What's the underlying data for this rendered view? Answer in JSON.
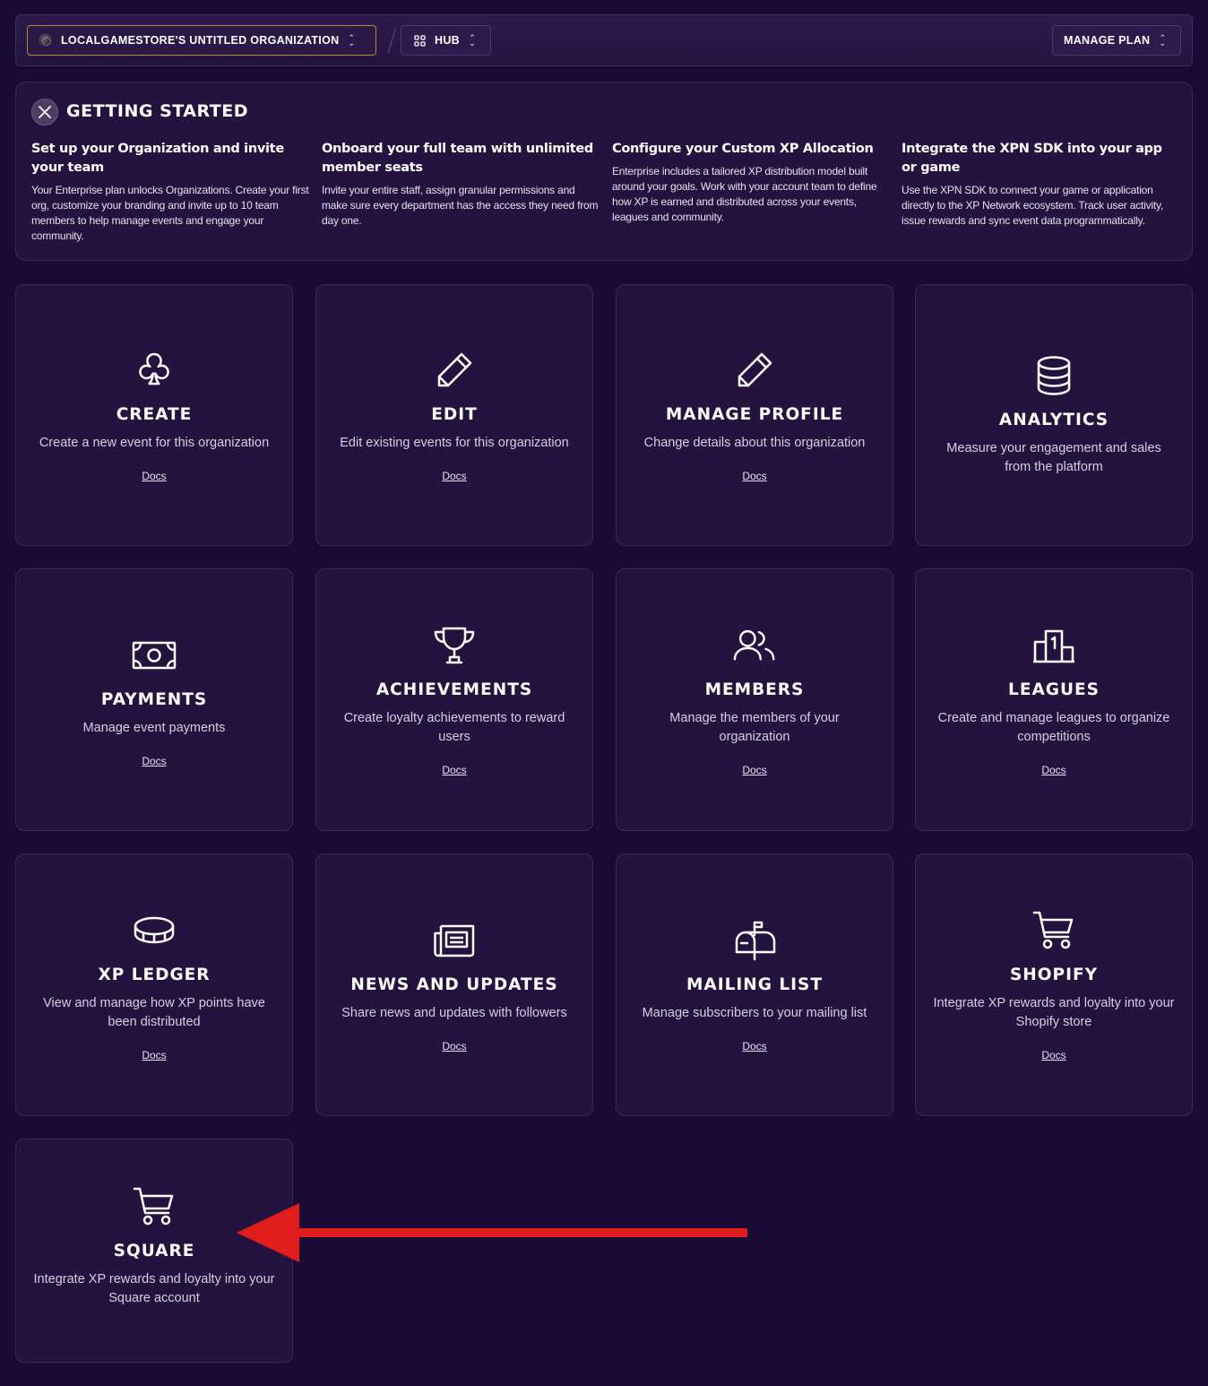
{
  "topbar": {
    "org_label": "LOCALGAMESTORE'S UNTITLED ORGANIZATION",
    "hub_label": "HUB",
    "plan_label": "MANAGE PLAN"
  },
  "getting_started": {
    "title": "GETTING STARTED",
    "steps": [
      {
        "title": "Set up your Organization and invite your team",
        "body": "Your Enterprise plan unlocks Organizations. Create your first org, customize your branding and invite up to 10 team members to help manage events and engage your community."
      },
      {
        "title": "Onboard your full team with unlimited member seats",
        "body": "Invite your entire staff, assign granular permissions and make sure every department has the access they need from day one."
      },
      {
        "title": "Configure your Custom XP Allocation",
        "body": "Enterprise includes a tailored XP distribution model built around your goals. Work with your account team to define how XP is earned and distributed across your events, leagues and community."
      },
      {
        "title": "Integrate the XPN SDK into your app or game",
        "body": "Use the XPN SDK to connect your game or application directly to the XP Network ecosystem. Track user activity, issue rewards and sync event data programmatically."
      }
    ]
  },
  "cards": [
    {
      "title": "CREATE",
      "desc": "Create a new event for this organization",
      "docs": "Docs",
      "icon": "club-icon"
    },
    {
      "title": "EDIT",
      "desc": "Edit existing events for this organization",
      "docs": "Docs",
      "icon": "pencil-icon"
    },
    {
      "title": "MANAGE PROFILE",
      "desc": "Change details about this organization",
      "docs": "Docs",
      "icon": "pencil-icon"
    },
    {
      "title": "ANALYTICS",
      "desc": "Measure your engagement and sales from the platform",
      "icon": "database-icon"
    },
    {
      "title": "PAYMENTS",
      "desc": "Manage event payments",
      "docs": "Docs",
      "icon": "cash-icon"
    },
    {
      "title": "ACHIEVEMENTS",
      "desc": "Create loyalty achievements to reward users",
      "docs": "Docs",
      "icon": "trophy-icon"
    },
    {
      "title": "MEMBERS",
      "desc": "Manage the members of your organization",
      "docs": "Docs",
      "icon": "users-icon"
    },
    {
      "title": "LEAGUES",
      "desc": "Create and manage leagues to organize competitions",
      "docs": "Docs",
      "icon": "podium-icon"
    },
    {
      "title": "XP LEDGER",
      "desc": "View and manage how XP points have been distributed",
      "docs": "Docs",
      "icon": "coin-icon"
    },
    {
      "title": "NEWS AND UPDATES",
      "desc": "Share news and updates with followers",
      "docs": "Docs",
      "icon": "newspaper-icon"
    },
    {
      "title": "MAILING LIST",
      "desc": "Manage subscribers to your mailing list",
      "docs": "Docs",
      "icon": "mailbox-icon"
    },
    {
      "title": "SHOPIFY",
      "desc": "Integrate XP rewards and loyalty into your Shopify store",
      "docs": "Docs",
      "icon": "cart-icon"
    },
    {
      "title": "SQUARE",
      "desc": "Integrate XP rewards and loyalty into your Square account",
      "icon": "cart-icon"
    }
  ],
  "colors": {
    "background": "#1a0a36",
    "card": "#24133f",
    "accent_border": "#b8892d",
    "arrow": "#e01c1c"
  }
}
